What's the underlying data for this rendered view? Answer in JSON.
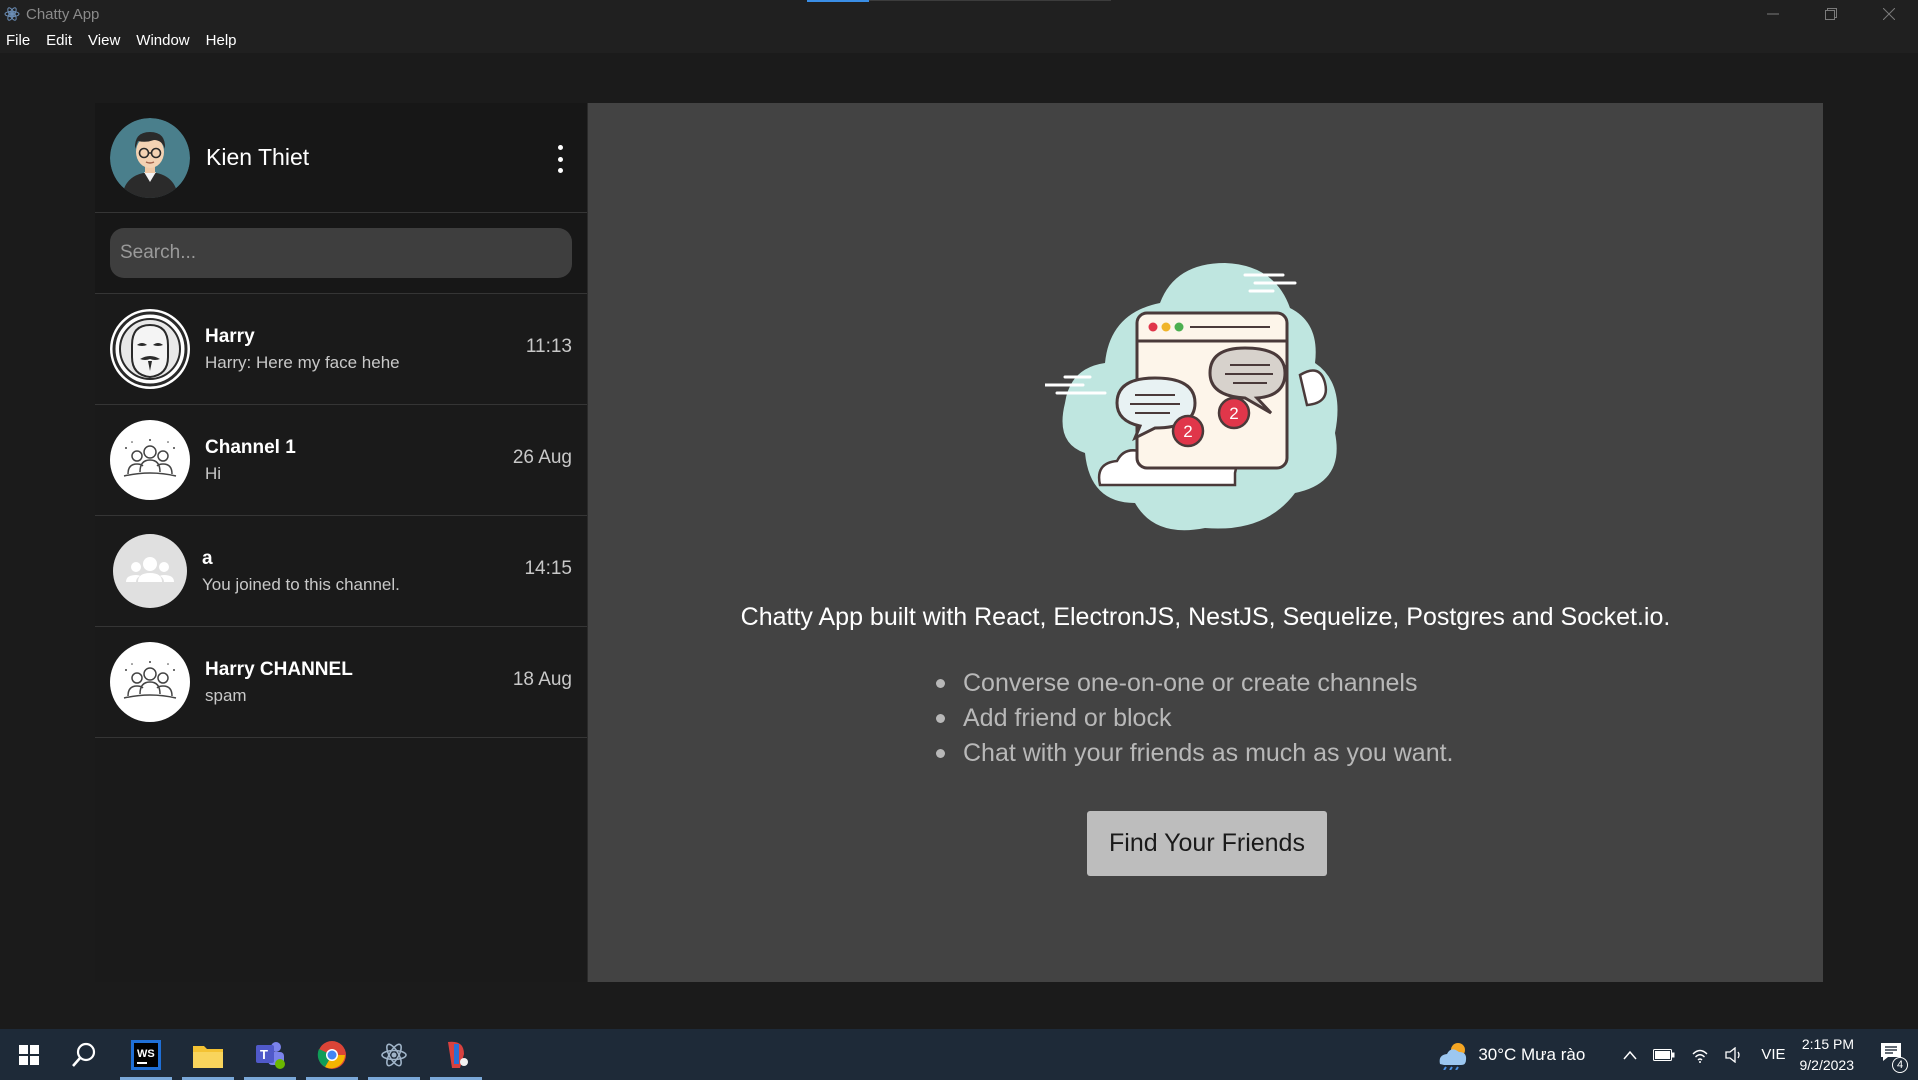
{
  "window": {
    "title": "Chatty App"
  },
  "menu": {
    "items": [
      "File",
      "Edit",
      "View",
      "Window",
      "Help"
    ]
  },
  "profile": {
    "name": "Kien Thiet"
  },
  "search": {
    "placeholder": "Search..."
  },
  "conversations": [
    {
      "name": "Harry",
      "last_message": "Harry: Here my face hehe",
      "time": "11:13",
      "avatar": "anonymous-mask-avatar"
    },
    {
      "name": "Channel 1",
      "last_message": "Hi",
      "time": "26 Aug",
      "avatar": "group-line-icon"
    },
    {
      "name": "a",
      "last_message": "You joined to this channel.",
      "time": "14:15",
      "avatar": "group-solid-icon"
    },
    {
      "name": "Harry CHANNEL",
      "last_message": "spam",
      "time": "18 Aug",
      "avatar": "group-line-icon"
    }
  ],
  "main": {
    "badge_left": "2",
    "badge_right": "2",
    "headline": "Chatty App built with React, ElectronJS, NestJS, Sequelize, Postgres and Socket.io.",
    "features": [
      "Converse one-on-one or create channels",
      "Add friend or block",
      "Chat with your friends as much as you want."
    ],
    "cta": "Find Your Friends"
  },
  "taskbar": {
    "weather": "30°C  Mưa rào",
    "language": "VIE",
    "time": "2:15 PM",
    "date": "9/2/2023",
    "notification_count": "4"
  },
  "colors": {
    "accent": "#3a8ee6",
    "badge": "#e0364a",
    "cloud": "#bfe6e0"
  }
}
